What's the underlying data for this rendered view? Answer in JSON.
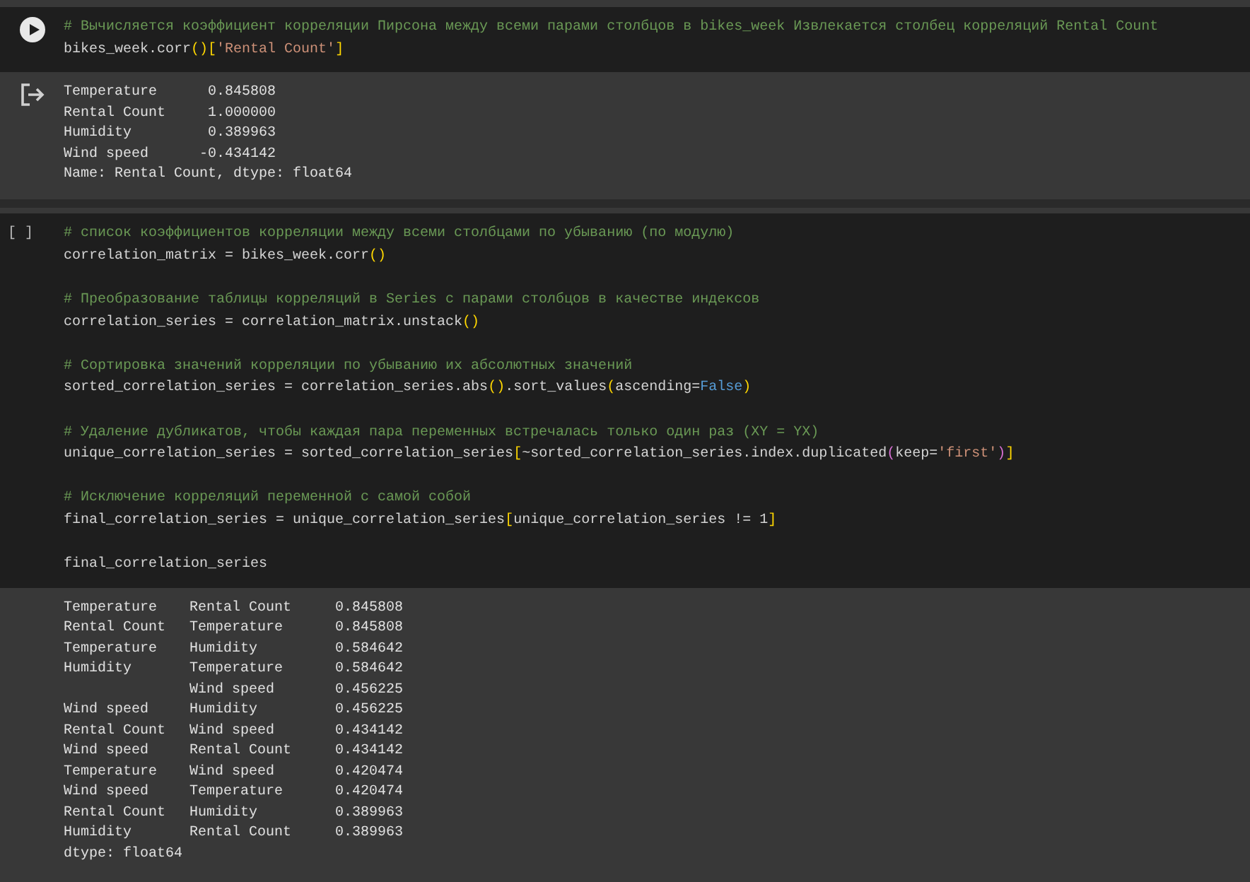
{
  "cells": [
    {
      "kind": "run",
      "code": [
        {
          "kind": "code",
          "tokens": [
            {
              "kind": "comment",
              "t": "# Вычисляется коэффициент корреляции Пирсона между всеми парами столбцов в bikes_week Извлекается столбец корреляций Rental Count"
            }
          ]
        },
        {
          "kind": "code",
          "tokens": [
            {
              "kind": "plain",
              "t": "bikes_week.corr"
            },
            {
              "kind": "paren",
              "t": "()"
            },
            {
              "kind": "bracket",
              "t": "["
            },
            {
              "kind": "string",
              "t": "'Rental Count'"
            },
            {
              "kind": "bracket",
              "t": "]"
            }
          ]
        }
      ],
      "output": {
        "rows": [
          [
            "Temperature",
            "0.845808"
          ],
          [
            "Rental Count",
            "1.000000"
          ],
          [
            "Humidity",
            "0.389963"
          ],
          [
            "Wind speed",
            "-0.434142"
          ]
        ],
        "footer": "Name: Rental Count, dtype: float64"
      }
    },
    {
      "kind": "idle",
      "prompt": "[ ]",
      "code": [
        {
          "kind": "code",
          "tokens": [
            {
              "kind": "comment",
              "t": "# список коэффициентов корреляции между всеми столбцами по убыванию (по модулю)"
            }
          ]
        },
        {
          "kind": "code",
          "tokens": [
            {
              "kind": "plain",
              "t": "correlation_matrix = bikes_week.corr"
            },
            {
              "kind": "paren",
              "t": "()"
            }
          ]
        },
        {
          "kind": "blank"
        },
        {
          "kind": "code",
          "tokens": [
            {
              "kind": "comment",
              "t": "# Преобразование таблицы корреляций в Series с парами столбцов в качестве индексов"
            }
          ]
        },
        {
          "kind": "code",
          "tokens": [
            {
              "kind": "plain",
              "t": "correlation_series = correlation_matrix.unstack"
            },
            {
              "kind": "paren",
              "t": "()"
            }
          ]
        },
        {
          "kind": "blank"
        },
        {
          "kind": "code",
          "tokens": [
            {
              "kind": "comment",
              "t": "# Сортировка значений корреляции по убыванию их абсолютных значений"
            }
          ]
        },
        {
          "kind": "code",
          "tokens": [
            {
              "kind": "plain",
              "t": "sorted_correlation_series = correlation_series.abs"
            },
            {
              "kind": "paren",
              "t": "()"
            },
            {
              "kind": "plain",
              "t": ".sort_values"
            },
            {
              "kind": "paren",
              "t": "("
            },
            {
              "kind": "plain",
              "t": "ascending="
            },
            {
              "kind": "keyword",
              "t": "False"
            },
            {
              "kind": "paren",
              "t": ")"
            }
          ]
        },
        {
          "kind": "blank"
        },
        {
          "kind": "code",
          "tokens": [
            {
              "kind": "comment",
              "t": "# Удаление дубликатов, чтобы каждая пара переменных встречалась только один раз (XY = YX)"
            }
          ]
        },
        {
          "kind": "code",
          "tokens": [
            {
              "kind": "plain",
              "t": "unique_correlation_series = sorted_correlation_series"
            },
            {
              "kind": "bracket",
              "t": "["
            },
            {
              "kind": "plain",
              "t": "~sorted_correlation_series.index.duplicated"
            },
            {
              "kind": "bracket2",
              "t": "("
            },
            {
              "kind": "plain",
              "t": "keep="
            },
            {
              "kind": "string",
              "t": "'first'"
            },
            {
              "kind": "bracket2",
              "t": ")"
            },
            {
              "kind": "bracket",
              "t": "]"
            }
          ]
        },
        {
          "kind": "blank"
        },
        {
          "kind": "code",
          "tokens": [
            {
              "kind": "comment",
              "t": "# Исключение корреляций переменной с самой собой"
            }
          ]
        },
        {
          "kind": "code",
          "tokens": [
            {
              "kind": "plain",
              "t": "final_correlation_series = unique_correlation_series"
            },
            {
              "kind": "bracket",
              "t": "["
            },
            {
              "kind": "plain",
              "t": "unique_correlation_series != 1"
            },
            {
              "kind": "bracket",
              "t": "]"
            }
          ]
        },
        {
          "kind": "blank"
        },
        {
          "kind": "code",
          "tokens": [
            {
              "kind": "plain",
              "t": "final_correlation_series"
            }
          ]
        }
      ],
      "output": {
        "rows": [
          [
            "Temperature",
            "Rental Count",
            "0.845808"
          ],
          [
            "Rental Count",
            "Temperature",
            "0.845808"
          ],
          [
            "Temperature",
            "Humidity",
            "0.584642"
          ],
          [
            "Humidity",
            "Temperature",
            "0.584642"
          ],
          [
            "",
            "Wind speed",
            "0.456225"
          ],
          [
            "Wind speed",
            "Humidity",
            "0.456225"
          ],
          [
            "Rental Count",
            "Wind speed",
            "0.434142"
          ],
          [
            "Wind speed",
            "Rental Count",
            "0.434142"
          ],
          [
            "Temperature",
            "Wind speed",
            "0.420474"
          ],
          [
            "Wind speed",
            "Temperature",
            "0.420474"
          ],
          [
            "Rental Count",
            "Humidity",
            "0.389963"
          ],
          [
            "Humidity",
            "Rental Count",
            "0.389963"
          ]
        ],
        "footer": "dtype: float64"
      }
    }
  ]
}
